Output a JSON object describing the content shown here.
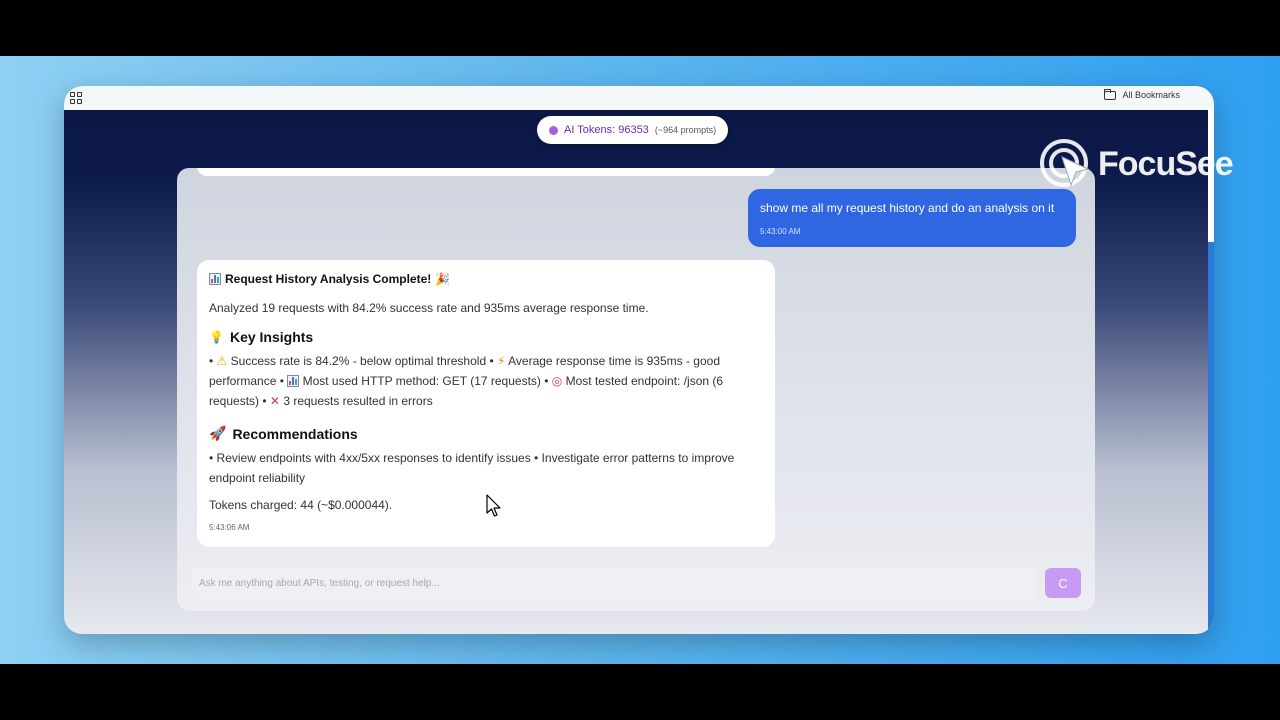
{
  "browser": {
    "bookmarks_label": "All Bookmarks"
  },
  "token_pill": {
    "label": "AI Tokens: 96353",
    "sub": "(~964 prompts)"
  },
  "user_message": {
    "text": "show me all my request history and do an analysis on it",
    "time": "5:43:00 AM"
  },
  "assistant_message": {
    "title": "Request History Analysis Complete!",
    "summary": "Analyzed 19 requests with 84.2% success rate and 935ms average response time.",
    "insights_heading": "Key Insights",
    "insights": {
      "b1": "Success rate is 84.2% - below optimal threshold •",
      "b2": "Average response time is 935ms - good performance •",
      "b3": "Most used HTTP method: GET (17 requests) •",
      "b4": "Most tested endpoint: /json (6 requests) •",
      "b5": "3 requests resulted in errors"
    },
    "recommendations_heading": "Recommendations",
    "recommendations": "• Review endpoints with 4xx/5xx responses to identify issues • Investigate error patterns to improve endpoint reliability",
    "tokens": "Tokens charged: 44 (~$0.000044).",
    "time": "5:43:06 AM"
  },
  "input": {
    "placeholder": "Ask me anything about APIs, testing, or request help...",
    "value": ""
  },
  "send_button": {
    "label": "C"
  },
  "watermark": {
    "text": "FocuSee"
  },
  "colors": {
    "user_bubble": "#2f67e3",
    "send_button": "#c79af3",
    "pill_text": "#6b2bb3",
    "stage_bg": "#5fb7ee"
  }
}
